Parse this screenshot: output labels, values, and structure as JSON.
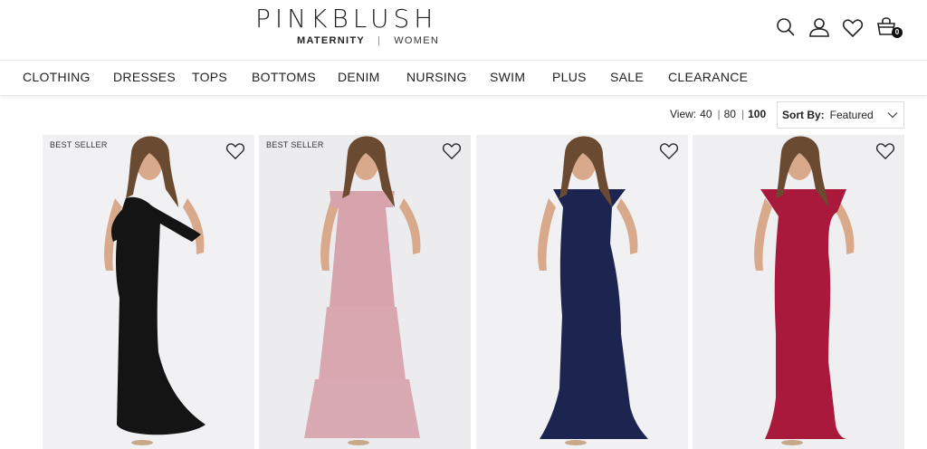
{
  "header": {
    "logo": "PINKBLUSH",
    "maternity_label": "MATERNITY",
    "separator": "|",
    "women_label": "WOMEN",
    "icons": [
      "search-icon",
      "user-icon",
      "heart-icon",
      "cart-icon"
    ],
    "cart_count": "0"
  },
  "nav": {
    "items": [
      {
        "label": "CLOTHING"
      },
      {
        "label": "DRESSES"
      },
      {
        "label": "TOPS"
      },
      {
        "label": "BOTTOMS"
      },
      {
        "label": "DENIM"
      },
      {
        "label": "NURSING"
      },
      {
        "label": "SWIM"
      },
      {
        "label": "PLUS"
      },
      {
        "label": "SALE"
      },
      {
        "label": "CLEARANCE"
      }
    ]
  },
  "toolbar": {
    "view_label": "View:",
    "view_options": [
      "40",
      "80",
      "100"
    ],
    "view_selected": "100",
    "sort_label": "Sort By:",
    "sort_value": "Featured"
  },
  "products": [
    {
      "badge": "BEST SELLER",
      "dress_color": "#141414",
      "bg": "#f1f1f3"
    },
    {
      "badge": "BEST SELLER",
      "dress_color": "#d7a3ac",
      "bg": "#ececef"
    },
    {
      "badge": "",
      "dress_color": "#1c2450",
      "bg": "#f1f1f3"
    },
    {
      "badge": "",
      "dress_color": "#a8193c",
      "bg": "#efeff1"
    }
  ]
}
